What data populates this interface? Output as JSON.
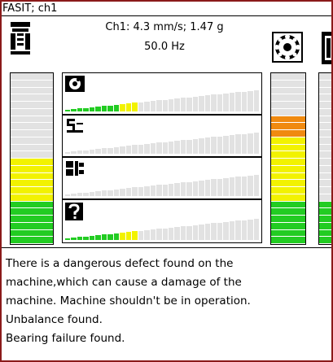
{
  "window": {
    "title": "FASIT; ch1"
  },
  "header": {
    "reading": "Ch1: 4.3 mm/s; 1.47 g",
    "frequency": "50.0 Hz",
    "icons": [
      "machine-icon",
      "bearing-icon",
      "clamp-icon"
    ]
  },
  "colors": {
    "frame": "#8b1a1a",
    "green": "#22cc22",
    "yellow": "#f2f200",
    "orange": "#f08a10",
    "gray": "#e2e2e2",
    "grayline": "#bdbdbd"
  },
  "left_gauge": {
    "segments": 24,
    "level": 0.5,
    "zones": [
      "green",
      "yellow"
    ]
  },
  "right_gauge": {
    "segments": 24,
    "level": 0.75,
    "zones": [
      "green",
      "yellow",
      "orange"
    ]
  },
  "far_right_gauge": {
    "segments": 24,
    "level": 0.25,
    "zones": [
      "green"
    ]
  },
  "diagnostic_rows": [
    {
      "icon": "unbalance-icon",
      "level": 0.38,
      "highlight": "yellow"
    },
    {
      "icon": "misalignment-icon",
      "level": 0.0,
      "highlight": "none"
    },
    {
      "icon": "looseness-icon",
      "level": 0.0,
      "highlight": "none"
    },
    {
      "icon": "bearing-question-icon",
      "level": 0.38,
      "highlight": "yellow"
    }
  ],
  "message": {
    "lines": [
      "There is a dangerous defect found on the",
      "machine,which can cause a damage of the",
      "machine. Machine shouldn't be in operation.",
      "Unbalance found.",
      "Bearing failure found."
    ]
  }
}
